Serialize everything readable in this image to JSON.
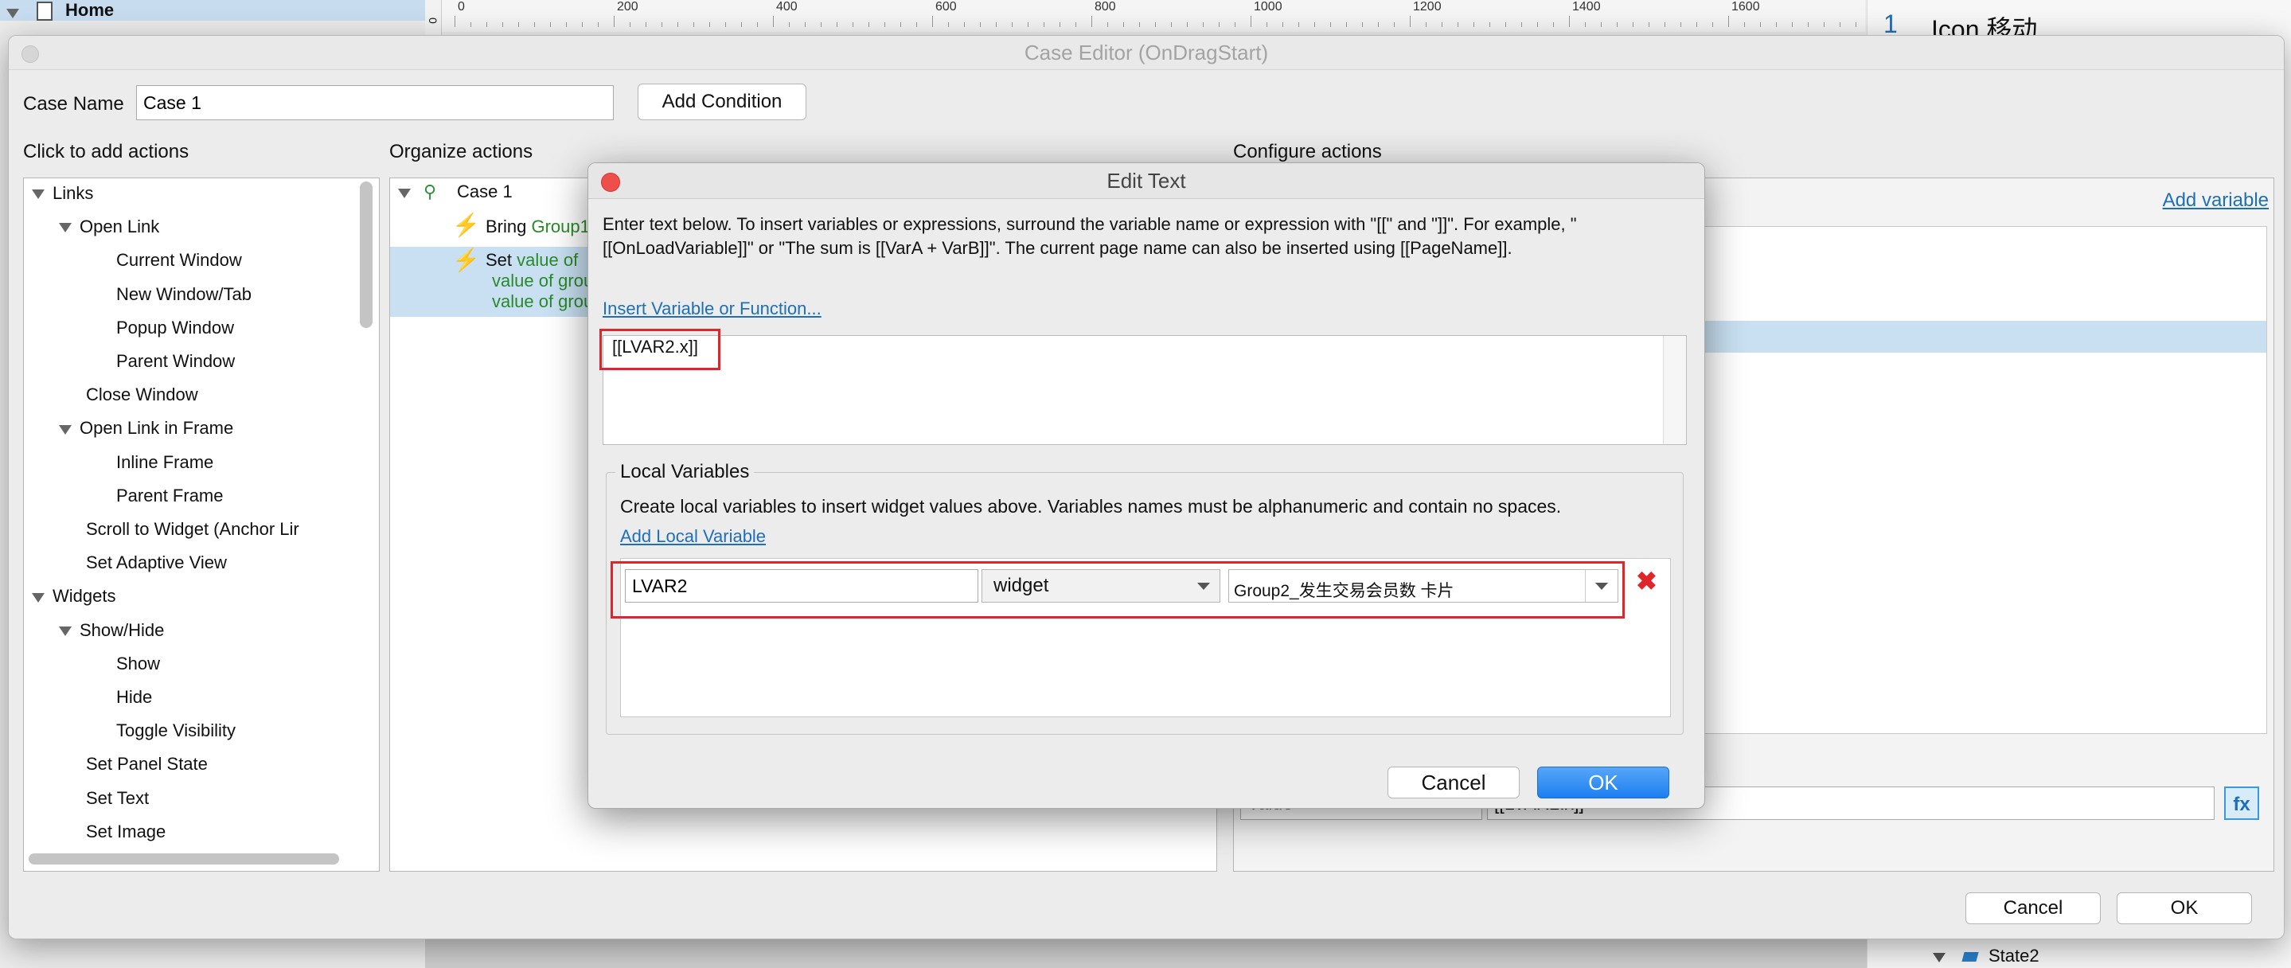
{
  "background": {
    "sitemap_home": "Home",
    "ruler_labels": [
      "0",
      "200",
      "400",
      "600",
      "800",
      "1000",
      "1200",
      "1400",
      "1600"
    ],
    "ruler_vertical_label": "0",
    "right_panel_number": "1",
    "right_panel_title": "Icon 移动",
    "right_panel_state": "State2"
  },
  "case_editor": {
    "title": "Case Editor (OnDragStart)",
    "case_name_label": "Case Name",
    "case_name_value": "Case 1",
    "add_condition": "Add Condition",
    "click_to_add_label": "Click to add actions",
    "organize_label": "Organize actions",
    "configure_label": "Configure actions",
    "add_variable": "Add variable",
    "actions_tree": [
      {
        "label": "Links",
        "level": 0,
        "expand": true
      },
      {
        "label": "Open Link",
        "level": 1,
        "expand": true
      },
      {
        "label": "Current Window",
        "level": 2
      },
      {
        "label": "New Window/Tab",
        "level": 2
      },
      {
        "label": "Popup Window",
        "level": 2
      },
      {
        "label": "Parent Window",
        "level": 2
      },
      {
        "label": "Close Window",
        "level": 1
      },
      {
        "label": "Open Link in Frame",
        "level": 1,
        "expand": true
      },
      {
        "label": "Inline Frame",
        "level": 2
      },
      {
        "label": "Parent Frame",
        "level": 2
      },
      {
        "label": "Scroll to Widget (Anchor Lir",
        "level": 1
      },
      {
        "label": "Set Adaptive View",
        "level": 1
      },
      {
        "label": "Widgets",
        "level": 0,
        "expand": true
      },
      {
        "label": "Show/Hide",
        "level": 1,
        "expand": true
      },
      {
        "label": "Show",
        "level": 2
      },
      {
        "label": "Hide",
        "level": 2
      },
      {
        "label": "Toggle Visibility",
        "level": 2
      },
      {
        "label": "Set Panel State",
        "level": 1
      },
      {
        "label": "Set Text",
        "level": 1
      },
      {
        "label": "Set Image",
        "level": 1
      }
    ],
    "organize": {
      "case": "Case 1",
      "action1_prefix": "Bring",
      "action1_green": "Group1",
      "action2_prefix": "Set",
      "action2_green": "value of",
      "action2_line2": "value of grou",
      "action2_line3": "value of grou"
    },
    "value_field_left": "Value",
    "value_field_right": "[[LVAR2.x]]",
    "fx_label": "fx",
    "cancel": "Cancel",
    "ok": "OK"
  },
  "edit_text": {
    "title": "Edit Text",
    "instructions": "Enter text below. To insert variables or expressions, surround the variable name or expression with \"[[\" and \"]]\". For example, \"[[OnLoadVariable]]\" or \"The sum is [[VarA + VarB]]\". The current page name can also be inserted using [[PageName]].",
    "insert_link": "Insert Variable or Function...",
    "text_value": "[[LVAR2.x]]",
    "local_vars_legend": "Local Variables",
    "local_vars_desc": "Create local variables to insert widget values above. Variables names must be alphanumeric and contain no spaces.",
    "add_local_var": "Add Local Variable",
    "var_name": "LVAR2",
    "equals": "=",
    "var_type": "widget",
    "var_target": "Group2_发生交易会员数 卡片",
    "cancel": "Cancel",
    "ok": "OK"
  }
}
